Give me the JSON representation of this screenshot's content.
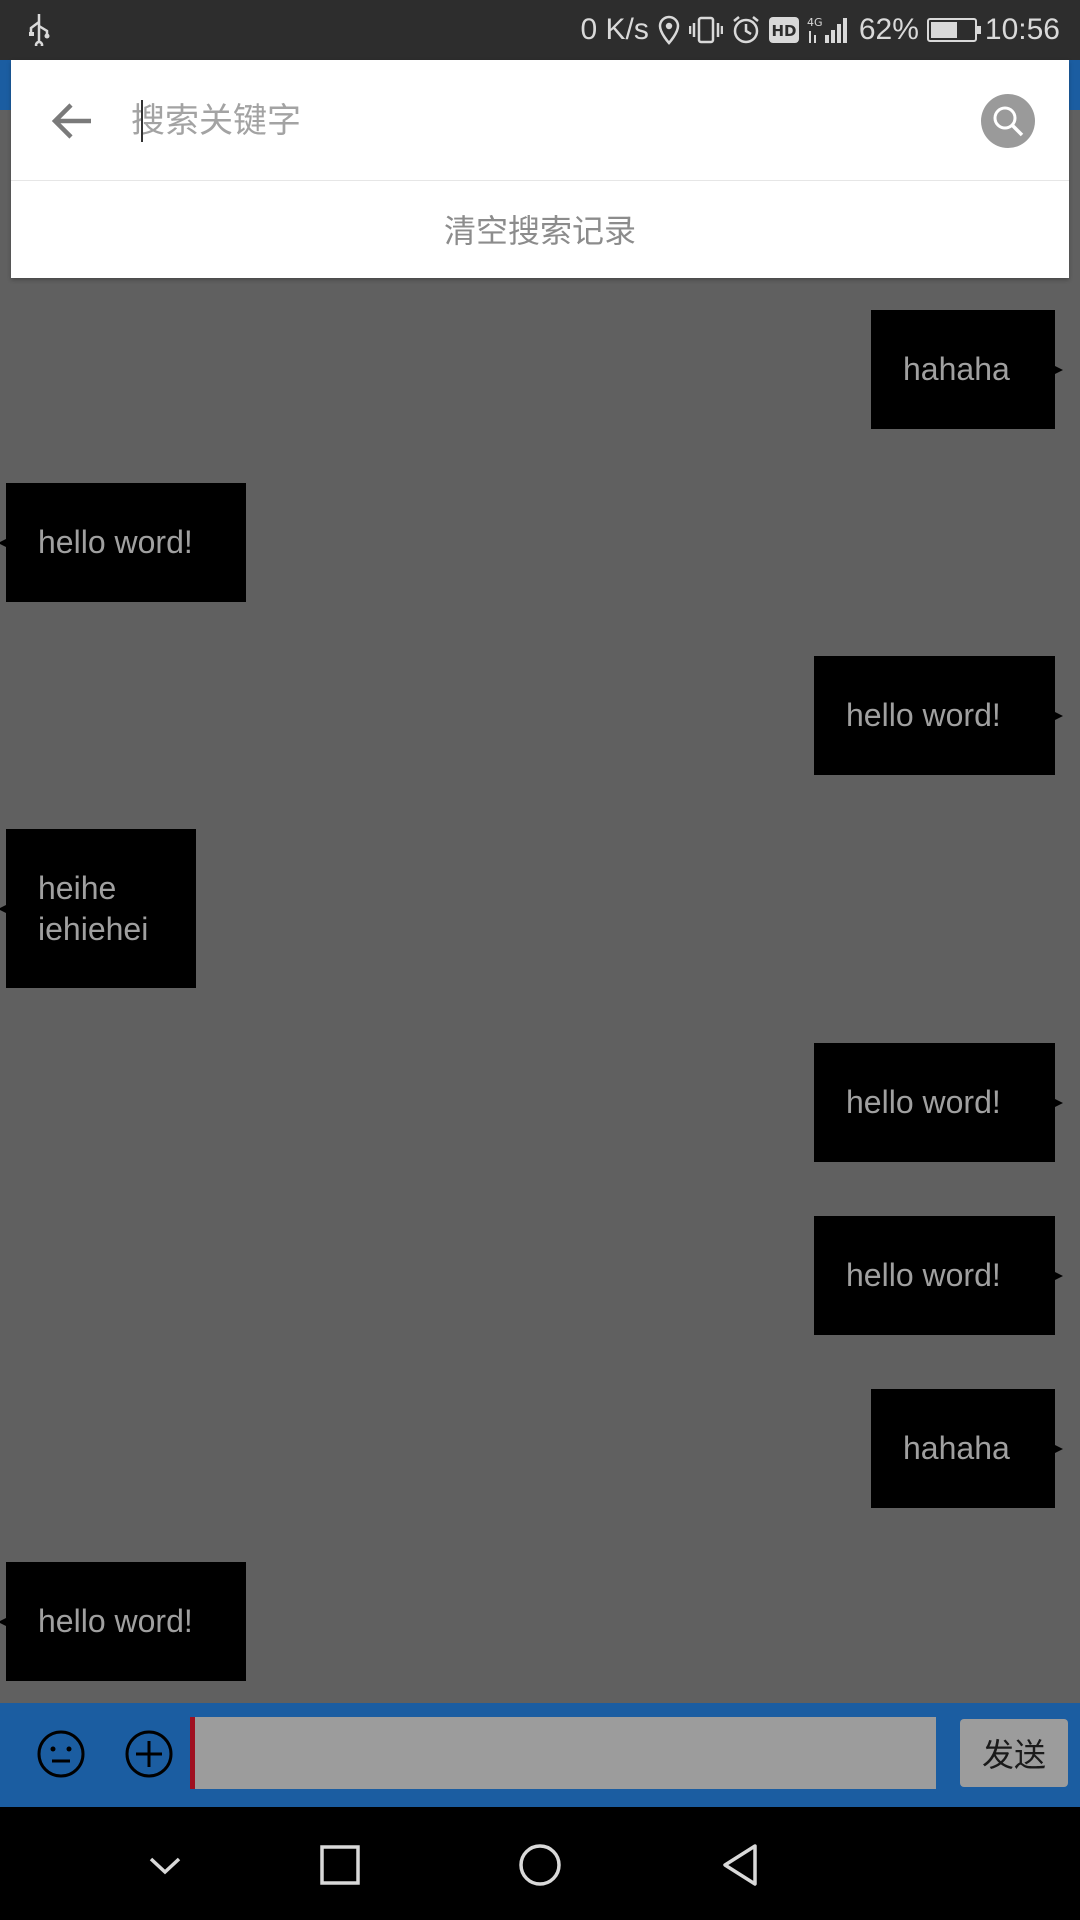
{
  "status_bar": {
    "net_speed": "0 K/s",
    "battery_percent": "62%",
    "battery_level": 0.62,
    "time": "10:56",
    "icons": [
      "usb-icon",
      "location-icon",
      "vibrate-icon",
      "alarm-icon",
      "hd-icon",
      "signal-4g-icon",
      "battery-charging-icon"
    ]
  },
  "search": {
    "placeholder": "搜索关键字",
    "value": "",
    "clear_history_label": "清空搜索记录"
  },
  "messages": [
    {
      "side": "right",
      "text": "hahaha"
    },
    {
      "side": "left",
      "text": "hello word!"
    },
    {
      "side": "right",
      "text": "hello word!"
    },
    {
      "side": "left",
      "text": "heihe iehiehei"
    },
    {
      "side": "right",
      "text": "hello word!"
    },
    {
      "side": "right",
      "text": "hello word!"
    },
    {
      "side": "right",
      "text": "hahaha"
    },
    {
      "side": "left",
      "text": "hello word!"
    }
  ],
  "composer": {
    "input_value": "",
    "send_label": "发送"
  },
  "colors": {
    "brand_blue": "#1b5da1",
    "overlay_gray": "#606060",
    "bubble": "#000000",
    "bubble_text": "#a0a0a0"
  }
}
